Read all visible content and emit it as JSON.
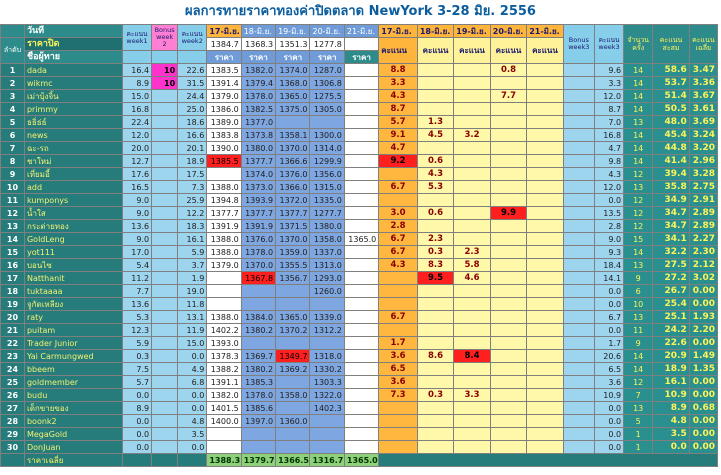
{
  "title": "ผลการทายราคาทองค่าปิดตลาด NewYork 3-28 มิย. 2556",
  "header": {
    "date_label": "วันที่",
    "close_label": "ราคาปิด",
    "name_label": "ชื่อผู้ทาย",
    "order_label": "ลำดับ",
    "score_week1": "คะแนน week1",
    "bonus_week2": "Bonus week 2",
    "score_week2": "คะแนน week2",
    "dates": [
      "17-มิ.ย.",
      "18-มิ.ย.",
      "19-มิ.ย.",
      "20-มิ.ย.",
      "21-มิ.ย."
    ],
    "close_prices": [
      "1384.7",
      "1368.3",
      "1351.3",
      "1277.8",
      ""
    ],
    "price_label": "ราคา",
    "score_label": "คะแนน",
    "score_dates": [
      "17-มิ.ย.",
      "18-มิ.ย.",
      "19-มิ.ย.",
      "20-มิ.ย.",
      "21-มิ.ย."
    ],
    "bonus_week3": "Bonus week3",
    "score_week3": "คะแนน week3",
    "count_label": "จำนวน ครั้ง",
    "total_label": "คะแนน สะสม",
    "avg_label": "คะแนน เฉลี่ย"
  },
  "rows": [
    {
      "i": "1",
      "name": "dada",
      "w1": "16.4",
      "b2": "10",
      "w2": "22.6",
      "p": [
        "1383.5",
        "1382.0",
        "1374.0",
        "1287.0",
        ""
      ],
      "s": [
        "8.8",
        "",
        "",
        "0.8",
        ""
      ],
      "b3": "",
      "w3": "9.6",
      "n": "14",
      "tot": "58.6",
      "avg": "3.47",
      "hl": [
        "b2"
      ]
    },
    {
      "i": "2",
      "name": "wikmc",
      "w1": "8.9",
      "b2": "10",
      "w2": "31.5",
      "p": [
        "1391.4",
        "1379.4",
        "1368.0",
        "1306.8",
        ""
      ],
      "s": [
        "3.3",
        "",
        "",
        "",
        ""
      ],
      "b3": "",
      "w3": "3.3",
      "n": "14",
      "tot": "53.7",
      "avg": "3.36",
      "hl": [
        "b2"
      ]
    },
    {
      "i": "3",
      "name": "เม่าบุ้งจิ้น",
      "w1": "15.0",
      "b2": "",
      "w2": "24.4",
      "p": [
        "1379.0",
        "1378.0",
        "1365.0",
        "1275.5",
        ""
      ],
      "s": [
        "4.3",
        "",
        "",
        "7.7",
        ""
      ],
      "b3": "",
      "w3": "12.0",
      "n": "14",
      "tot": "51.4",
      "avg": "3.67",
      "hl": []
    },
    {
      "i": "4",
      "name": "primmy",
      "w1": "16.8",
      "b2": "",
      "w2": "25.0",
      "p": [
        "1386.0",
        "1382.5",
        "1375.0",
        "1305.0",
        ""
      ],
      "s": [
        "8.7",
        "",
        "",
        "",
        ""
      ],
      "b3": "",
      "w3": "8.7",
      "n": "14",
      "tot": "50.5",
      "avg": "3.61",
      "hl": []
    },
    {
      "i": "5",
      "name": "ธธิ่ธ่ธ์",
      "w1": "22.4",
      "b2": "",
      "w2": "18.6",
      "p": [
        "1389.0",
        "1377.0",
        "",
        "",
        ""
      ],
      "s": [
        "5.7",
        "1.3",
        "",
        "",
        ""
      ],
      "b3": "",
      "w3": "7.0",
      "n": "13",
      "tot": "48.0",
      "avg": "3.69",
      "hl": []
    },
    {
      "i": "6",
      "name": "news",
      "w1": "12.0",
      "b2": "",
      "w2": "16.6",
      "p": [
        "1383.8",
        "1373.8",
        "1358.1",
        "1300.0",
        ""
      ],
      "s": [
        "9.1",
        "4.5",
        "3.2",
        "",
        ""
      ],
      "b3": "",
      "w3": "16.8",
      "n": "14",
      "tot": "45.4",
      "avg": "3.24",
      "hl": []
    },
    {
      "i": "7",
      "name": "ฉะ-รถ",
      "w1": "20.0",
      "b2": "",
      "w2": "20.1",
      "p": [
        "1390.0",
        "1380.0",
        "1370.0",
        "1314.0",
        ""
      ],
      "s": [
        "4.7",
        "",
        "",
        "",
        ""
      ],
      "b3": "",
      "w3": "4.7",
      "n": "14",
      "tot": "44.8",
      "avg": "3.20",
      "hl": []
    },
    {
      "i": "8",
      "name": "ชาใหม่",
      "w1": "12.7",
      "b2": "",
      "w2": "18.9",
      "p": [
        "1385.5",
        "1377.7",
        "1366.6",
        "1299.9",
        ""
      ],
      "s": [
        "9.2",
        "0.6",
        "",
        "",
        ""
      ],
      "b3": "",
      "w3": "9.8",
      "n": "14",
      "tot": "41.4",
      "avg": "2.96",
      "hl": [
        "p0",
        "s0"
      ]
    },
    {
      "i": "9",
      "name": "เที่ยมอี้",
      "w1": "17.6",
      "b2": "",
      "w2": "17.5",
      "p": [
        "",
        "1374.0",
        "1376.0",
        "1356.0",
        ""
      ],
      "s": [
        "",
        "4.3",
        "",
        "",
        ""
      ],
      "b3": "",
      "w3": "4.3",
      "n": "12",
      "tot": "39.4",
      "avg": "3.28",
      "hl": []
    },
    {
      "i": "10",
      "name": "add",
      "w1": "16.5",
      "b2": "",
      "w2": "7.3",
      "p": [
        "1388.0",
        "1373.0",
        "1366.0",
        "1315.0",
        ""
      ],
      "s": [
        "6.7",
        "5.3",
        "",
        "",
        ""
      ],
      "b3": "",
      "w3": "12.0",
      "n": "13",
      "tot": "35.8",
      "avg": "2.75",
      "hl": []
    },
    {
      "i": "11",
      "name": "kumponys",
      "w1": "9.0",
      "b2": "",
      "w2": "25.9",
      "p": [
        "1394.8",
        "1393.9",
        "1372.0",
        "1335.0",
        ""
      ],
      "s": [
        "",
        "",
        "",
        "",
        ""
      ],
      "b3": "",
      "w3": "0.0",
      "n": "12",
      "tot": "34.9",
      "avg": "2.91",
      "hl": []
    },
    {
      "i": "12",
      "name": "น้ำใส",
      "w1": "9.0",
      "b2": "",
      "w2": "12.2",
      "p": [
        "1377.7",
        "1377.7",
        "1377.7",
        "1277.7",
        ""
      ],
      "s": [
        "3.0",
        "0.6",
        "",
        "9.9",
        ""
      ],
      "b3": "",
      "w3": "13.5",
      "n": "12",
      "tot": "34.7",
      "avg": "2.89",
      "hl": [
        "s3"
      ]
    },
    {
      "i": "13",
      "name": "กระต่ายทอง",
      "w1": "13.6",
      "b2": "",
      "w2": "18.3",
      "p": [
        "1391.9",
        "1391.9",
        "1371.5",
        "1380.0",
        ""
      ],
      "s": [
        "2.8",
        "",
        "",
        "",
        ""
      ],
      "b3": "",
      "w3": "2.8",
      "n": "12",
      "tot": "34.7",
      "avg": "2.89",
      "hl": []
    },
    {
      "i": "14",
      "name": "GoldLeng",
      "w1": "9.0",
      "b2": "",
      "w2": "16.1",
      "p": [
        "1388.0",
        "1376.0",
        "1370.0",
        "1358.0",
        "1365.0"
      ],
      "s": [
        "6.7",
        "2.3",
        "",
        "",
        ""
      ],
      "b3": "",
      "w3": "9.0",
      "n": "15",
      "tot": "34.1",
      "avg": "2.27",
      "hl": []
    },
    {
      "i": "15",
      "name": "yot111",
      "w1": "17.0",
      "b2": "",
      "w2": "5.9",
      "p": [
        "1388.0",
        "1378.0",
        "1359.0",
        "1337.0",
        ""
      ],
      "s": [
        "6.7",
        "0.3",
        "2.3",
        "",
        ""
      ],
      "b3": "",
      "w3": "9.3",
      "n": "14",
      "tot": "32.2",
      "avg": "2.30",
      "hl": []
    },
    {
      "i": "16",
      "name": "บอนไซ",
      "w1": "5.4",
      "b2": "",
      "w2": "3.7",
      "p": [
        "1379.0",
        "1370.0",
        "1355.5",
        "1313.0",
        ""
      ],
      "s": [
        "4.3",
        "8.3",
        "5.8",
        "",
        ""
      ],
      "b3": "",
      "w3": "18.4",
      "n": "13",
      "tot": "27.5",
      "avg": "2.12",
      "hl": []
    },
    {
      "i": "17",
      "name": "Natthanit",
      "w1": "11.2",
      "b2": "",
      "w2": "1.9",
      "p": [
        "",
        "1367.8",
        "1356.7",
        "1293.0",
        ""
      ],
      "s": [
        "",
        "9.5",
        "4.6",
        "",
        ""
      ],
      "b3": "",
      "w3": "14.1",
      "n": "9",
      "tot": "27.2",
      "avg": "3.02",
      "hl": [
        "p1",
        "s1"
      ]
    },
    {
      "i": "18",
      "name": "tuktaaaa",
      "w1": "7.7",
      "b2": "",
      "w2": "19.0",
      "p": [
        "",
        "",
        "",
        "1260.0",
        ""
      ],
      "s": [
        "",
        "",
        "",
        "",
        ""
      ],
      "b3": "",
      "w3": "0.0",
      "n": "6",
      "tot": "26.7",
      "avg": "0.00",
      "hl": []
    },
    {
      "i": "19",
      "name": "จูกัดเหลียง",
      "w1": "13.6",
      "b2": "",
      "w2": "11.8",
      "p": [
        "",
        "",
        "",
        "",
        ""
      ],
      "s": [
        "",
        "",
        "",
        "",
        ""
      ],
      "b3": "",
      "w3": "0.0",
      "n": "10",
      "tot": "25.4",
      "avg": "0.00",
      "hl": []
    },
    {
      "i": "20",
      "name": "raty",
      "w1": "5.3",
      "b2": "",
      "w2": "13.1",
      "p": [
        "1388.0",
        "1384.0",
        "1365.0",
        "1339.0",
        ""
      ],
      "s": [
        "6.7",
        "",
        "",
        "",
        ""
      ],
      "b3": "",
      "w3": "6.7",
      "n": "13",
      "tot": "25.1",
      "avg": "1.93",
      "hl": []
    },
    {
      "i": "21",
      "name": "puitam",
      "w1": "12.3",
      "b2": "",
      "w2": "11.9",
      "p": [
        "1402.2",
        "1380.2",
        "1370.2",
        "1312.2",
        ""
      ],
      "s": [
        "",
        "",
        "",
        "",
        ""
      ],
      "b3": "",
      "w3": "0.0",
      "n": "11",
      "tot": "24.2",
      "avg": "2.20",
      "hl": []
    },
    {
      "i": "22",
      "name": "Trader Junior",
      "w1": "5.9",
      "b2": "",
      "w2": "15.0",
      "p": [
        "1393.0",
        "",
        "",
        "",
        ""
      ],
      "s": [
        "1.7",
        "",
        "",
        "",
        ""
      ],
      "b3": "",
      "w3": "1.7",
      "n": "9",
      "tot": "22.6",
      "avg": "0.00",
      "hl": []
    },
    {
      "i": "23",
      "name": "Yai Carmungwed",
      "w1": "0.3",
      "b2": "",
      "w2": "0.0",
      "p": [
        "1378.3",
        "1369.7",
        "1349.7",
        "1318.0",
        ""
      ],
      "s": [
        "3.6",
        "8.6",
        "8.4",
        "",
        ""
      ],
      "b3": "",
      "w3": "20.6",
      "n": "14",
      "tot": "20.9",
      "avg": "1.49",
      "hl": [
        "p2",
        "s2"
      ]
    },
    {
      "i": "24",
      "name": "bbeem",
      "w1": "7.5",
      "b2": "",
      "w2": "4.9",
      "p": [
        "1388.2",
        "1380.2",
        "1369.2",
        "1330.2",
        ""
      ],
      "s": [
        "6.5",
        "",
        "",
        "",
        ""
      ],
      "b3": "",
      "w3": "6.5",
      "n": "14",
      "tot": "18.9",
      "avg": "1.35",
      "hl": []
    },
    {
      "i": "25",
      "name": "goldmember",
      "w1": "5.7",
      "b2": "",
      "w2": "6.8",
      "p": [
        "1391.1",
        "1385.3",
        "",
        "1303.3",
        ""
      ],
      "s": [
        "3.6",
        "",
        "",
        "",
        ""
      ],
      "b3": "",
      "w3": "3.6",
      "n": "12",
      "tot": "16.1",
      "avg": "0.00",
      "hl": []
    },
    {
      "i": "26",
      "name": "budu",
      "w1": "0.0",
      "b2": "",
      "w2": "0.0",
      "p": [
        "1382.0",
        "1378.0",
        "1358.0",
        "1322.0",
        ""
      ],
      "s": [
        "7.3",
        "0.3",
        "3.3",
        "",
        ""
      ],
      "b3": "",
      "w3": "10.9",
      "n": "7",
      "tot": "10.9",
      "avg": "0.00",
      "hl": []
    },
    {
      "i": "27",
      "name": "เด็กขายของ",
      "w1": "8.9",
      "b2": "",
      "w2": "0.0",
      "p": [
        "1401.5",
        "1385.6",
        "",
        "1402.3",
        ""
      ],
      "s": [
        "",
        "",
        "",
        "",
        ""
      ],
      "b3": "",
      "w3": "0.0",
      "n": "13",
      "tot": "8.9",
      "avg": "0.68",
      "hl": []
    },
    {
      "i": "28",
      "name": "boonk2",
      "w1": "0.0",
      "b2": "",
      "w2": "4.8",
      "p": [
        "1400.0",
        "1397.0",
        "1360.0",
        "",
        ""
      ],
      "s": [
        "",
        "",
        "",
        "",
        ""
      ],
      "b3": "",
      "w3": "0.0",
      "n": "5",
      "tot": "4.8",
      "avg": "0.00",
      "hl": []
    },
    {
      "i": "29",
      "name": "MegaGold",
      "w1": "0.0",
      "b2": "",
      "w2": "3.5",
      "p": [
        "",
        "",
        "",
        "",
        ""
      ],
      "s": [
        "",
        "",
        "",
        "",
        ""
      ],
      "b3": "",
      "w3": "0.0",
      "n": "1",
      "tot": "3.5",
      "avg": "0.00",
      "hl": []
    },
    {
      "i": "30",
      "name": "DonJuan",
      "w1": "0.0",
      "b2": "",
      "w2": "0.0",
      "p": [
        "",
        "",
        "",
        "",
        ""
      ],
      "s": [
        "",
        "",
        "",
        "",
        ""
      ],
      "b3": "",
      "w3": "0.0",
      "n": "1",
      "tot": "0.0",
      "avg": "0.00",
      "hl": []
    }
  ],
  "footer": {
    "label": "ราคาเฉลี่ย",
    "avgs": [
      "1388.3",
      "1379.7",
      "1366.5",
      "1316.7",
      "1365.0"
    ]
  },
  "colors": {
    "teal": "#267b7b",
    "sky": "#9dd5ef",
    "blue": "#7ea6e0",
    "orange": "#ffb73f",
    "cream": "#fff8a8",
    "highlight_red": "#ff1f1f",
    "highlight_magenta": "#ff33cc"
  }
}
